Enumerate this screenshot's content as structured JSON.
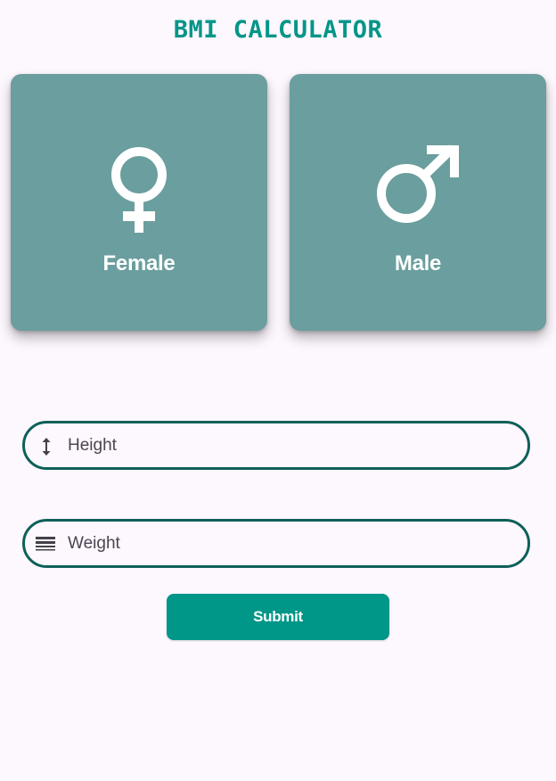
{
  "app": {
    "title": "BMI CALCULATOR"
  },
  "gender_options": {
    "female": {
      "label": "Female",
      "icon": "female-symbol-icon"
    },
    "male": {
      "label": "Male",
      "icon": "male-symbol-icon"
    }
  },
  "form": {
    "height": {
      "placeholder": "Height",
      "value": "",
      "icon": "height-arrows-icon"
    },
    "weight": {
      "placeholder": "Weight",
      "value": "",
      "icon": "weight-lines-icon"
    },
    "submit_label": "Submit"
  },
  "colors": {
    "accent": "#009688",
    "card": "#6b9e9e",
    "field_border": "#0e6059",
    "background": "#fdf7fe"
  }
}
